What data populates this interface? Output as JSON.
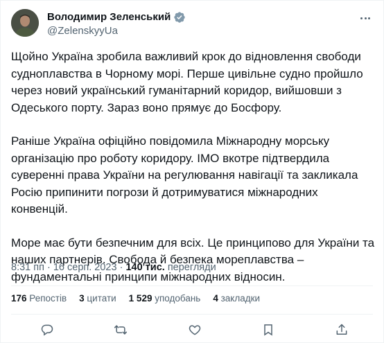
{
  "tweet": {
    "author_name": "Володимир Зеленський",
    "handle": "@ZelenskyyUa",
    "paragraphs": [
      "Щойно Україна зробила важливий крок до відновлення свободи судноплавства в Чорному морі. Перше цивільне судно пройшло через новий український гуманітарний коридор, вийшовши з Одеського порту. Зараз воно прямує до Босфору.",
      "Раніше Україна офіційно повідомила Міжнародну морську організацію про роботу коридору. IMO вкотре підтвердила суверенні права України на регулювання навігації та закликала Росію припинити погрози й дотримуватися міжнародних конвенцій.",
      "Море має бути безпечним для всіх. Це принципово для України та наших партнерів. Свобода й безпека мореплавства – фундаментальні принципи міжнародних відносин."
    ],
    "time": "8:31 пп",
    "date": "16 серп. 2023",
    "views_count": "140 тис.",
    "views_label": "перегляди"
  },
  "stats": {
    "reposts_count": "176",
    "reposts_label": "Репостів",
    "quotes_count": "3",
    "quotes_label": "цитати",
    "likes_count": "1 529",
    "likes_label": "уподобань",
    "bookmarks_count": "4",
    "bookmarks_label": "закладки"
  },
  "icons": [
    "verified-badge-icon",
    "more-icon",
    "reply-icon",
    "repost-icon",
    "like-icon",
    "bookmark-icon",
    "share-icon"
  ],
  "colors": {
    "text": "#0f1419",
    "secondary": "#536471",
    "verified": "#829aab",
    "border": "#eff3f4"
  }
}
